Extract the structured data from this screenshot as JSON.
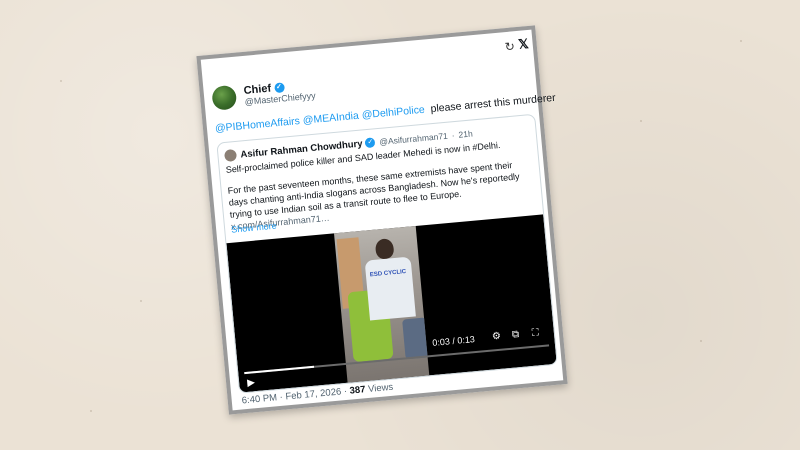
{
  "tweet": {
    "author_name": "Chief",
    "author_handle": "@MasterChiefyyy",
    "mentions": [
      "@PIBHomeAffairs",
      "@MEAIndia",
      "@DelhiPolice"
    ],
    "text": "please arrest this murderer",
    "time": "6:40 PM",
    "date": "Feb 17, 2026",
    "views_count": "387",
    "views_label": "Views"
  },
  "quote": {
    "author_name": "Asifur Rahman Chowdhury",
    "author_handle": "@Asifurrahman71",
    "age": "21h",
    "line1": "Self-proclaimed police killer and SAD leader Mehedi is now in #Delhi.",
    "para": "For the past seventeen months, these same extremists have spent their days chanting anti-India slogans across Bangladesh. Now he's reportedly trying to use Indian soil as a transit route to flee to Europe.",
    "link": "x.com/Asifurrahman71…",
    "show_more": "Show more"
  },
  "video": {
    "shirt_text": "ESD CYCLIC",
    "current_time": "0:03",
    "total_time": "0:13",
    "time_separator": "/",
    "progress": 0.23
  },
  "icons": {
    "refresh": "refresh-icon",
    "x_logo": "x-logo-icon",
    "verified": "verified-badge-icon",
    "play": "play-icon",
    "settings": "gear-icon",
    "pip": "picture-in-picture-icon",
    "fullscreen": "fullscreen-icon"
  },
  "colors": {
    "accent": "#1d9bf0",
    "background": "#ebe2d5",
    "text": "#0f1419",
    "muted": "#536471"
  }
}
